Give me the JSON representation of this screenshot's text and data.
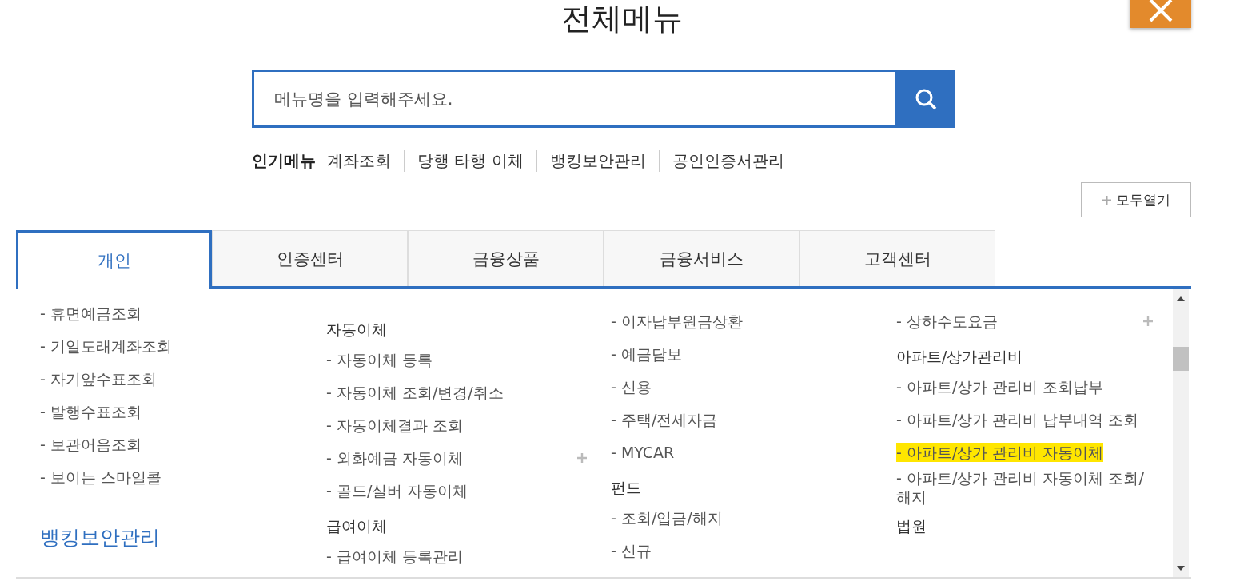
{
  "title": "전체메뉴",
  "search": {
    "placeholder": "메뉴명을 입력해주세요."
  },
  "popular": {
    "label": "인기메뉴",
    "links": [
      "계좌조회",
      "당행 타행 이체",
      "뱅킹보안관리",
      "공인인증서관리"
    ]
  },
  "expand_all": {
    "label": "모두열기"
  },
  "tabs": [
    {
      "label": "개인",
      "selected": true
    },
    {
      "label": "인증센터",
      "selected": false
    },
    {
      "label": "금융상품",
      "selected": false
    },
    {
      "label": "금융서비스",
      "selected": false
    },
    {
      "label": "고객센터",
      "selected": false
    }
  ],
  "columns": [
    {
      "items": [
        {
          "kind": "item",
          "label": "- 휴면예금조회"
        },
        {
          "kind": "item",
          "label": "- 기일도래계좌조회"
        },
        {
          "kind": "item",
          "label": "- 자기앞수표조회"
        },
        {
          "kind": "item",
          "label": "- 발행수표조회"
        },
        {
          "kind": "item",
          "label": "- 보관어음조회"
        },
        {
          "kind": "item",
          "label": "- 보이는 스마일콜"
        },
        {
          "kind": "section",
          "label": "뱅킹보안관리"
        }
      ]
    },
    {
      "items": [
        {
          "kind": "group",
          "label": "자동이체"
        },
        {
          "kind": "item",
          "label": "- 자동이체 등록"
        },
        {
          "kind": "item",
          "label": "- 자동이체 조회/변경/취소"
        },
        {
          "kind": "item",
          "label": "- 자동이체결과 조회"
        },
        {
          "kind": "item",
          "label": "- 외화예금 자동이체",
          "expandable": true
        },
        {
          "kind": "item",
          "label": "- 골드/실버 자동이체"
        },
        {
          "kind": "group",
          "label": "급여이체"
        },
        {
          "kind": "item",
          "label": "- 급여이체 등록관리"
        }
      ]
    },
    {
      "items": [
        {
          "kind": "item",
          "label": "- 이자납부원금상환"
        },
        {
          "kind": "item",
          "label": "- 예금담보"
        },
        {
          "kind": "item",
          "label": "- 신용"
        },
        {
          "kind": "item",
          "label": "- 주택/전세자금"
        },
        {
          "kind": "item",
          "label": "- MYCAR"
        },
        {
          "kind": "group",
          "label": "펀드"
        },
        {
          "kind": "item",
          "label": "- 조회/입금/해지"
        },
        {
          "kind": "item",
          "label": "- 신규"
        }
      ]
    },
    {
      "items": [
        {
          "kind": "item",
          "label": "- 상하수도요금",
          "expandable": true
        },
        {
          "kind": "group",
          "label": "아파트/상가관리비"
        },
        {
          "kind": "item",
          "label": "- 아파트/상가 관리비 조회납부"
        },
        {
          "kind": "item",
          "label": "- 아파트/상가 관리비 납부내역 조회"
        },
        {
          "kind": "item",
          "label": "- 아파트/상가 관리비 자동이체",
          "highlighted": true
        },
        {
          "kind": "item",
          "label": "- 아파트/상가 관리비 자동이체 조회/해지"
        },
        {
          "kind": "group",
          "label": "법원"
        }
      ]
    }
  ]
}
